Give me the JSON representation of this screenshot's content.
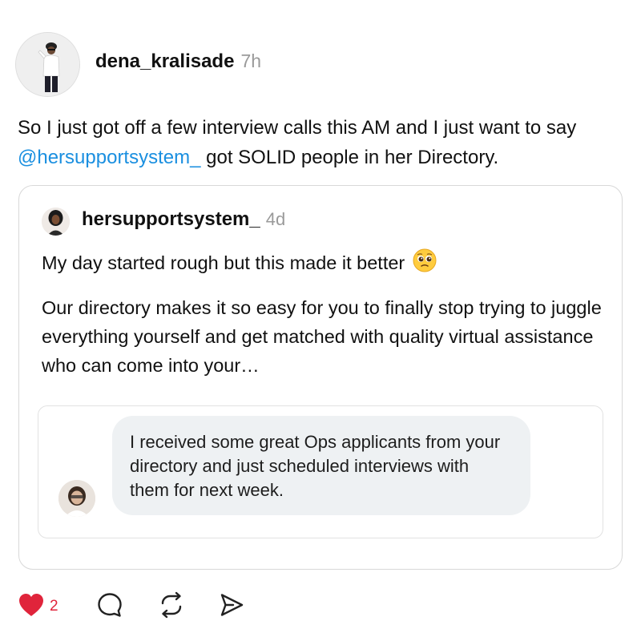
{
  "post": {
    "username": "dena_kralisade",
    "time": "7h",
    "text_before": "So I just got off a few interview calls this AM and I just want to say ",
    "mention": "@hersupportsystem_",
    "text_after": " got SOLID people in her Directory."
  },
  "quoted_post": {
    "username": "hersupportsystem_",
    "time": "4d",
    "line1": "My day started rough but this made it better",
    "emoji_icon": "pleading-face-emoji",
    "body": "Our directory makes it so easy for you to finally stop trying to juggle everything yourself and get matched with quality virtual assistance who can come into your…",
    "embedded_message": {
      "text": "I received some great Ops applicants from your directory and just scheduled interviews with them for next week."
    }
  },
  "actions": {
    "like_count": "2",
    "like_icon": "heart-icon",
    "comment_icon": "comment-icon",
    "repost_icon": "repost-icon",
    "share_icon": "send-icon",
    "like_color": "#e0243b"
  },
  "colors": {
    "mention": "#1a8fe0",
    "muted": "#9a9a9a",
    "bubble": "#eef1f3",
    "border": "#d8d8d8"
  }
}
